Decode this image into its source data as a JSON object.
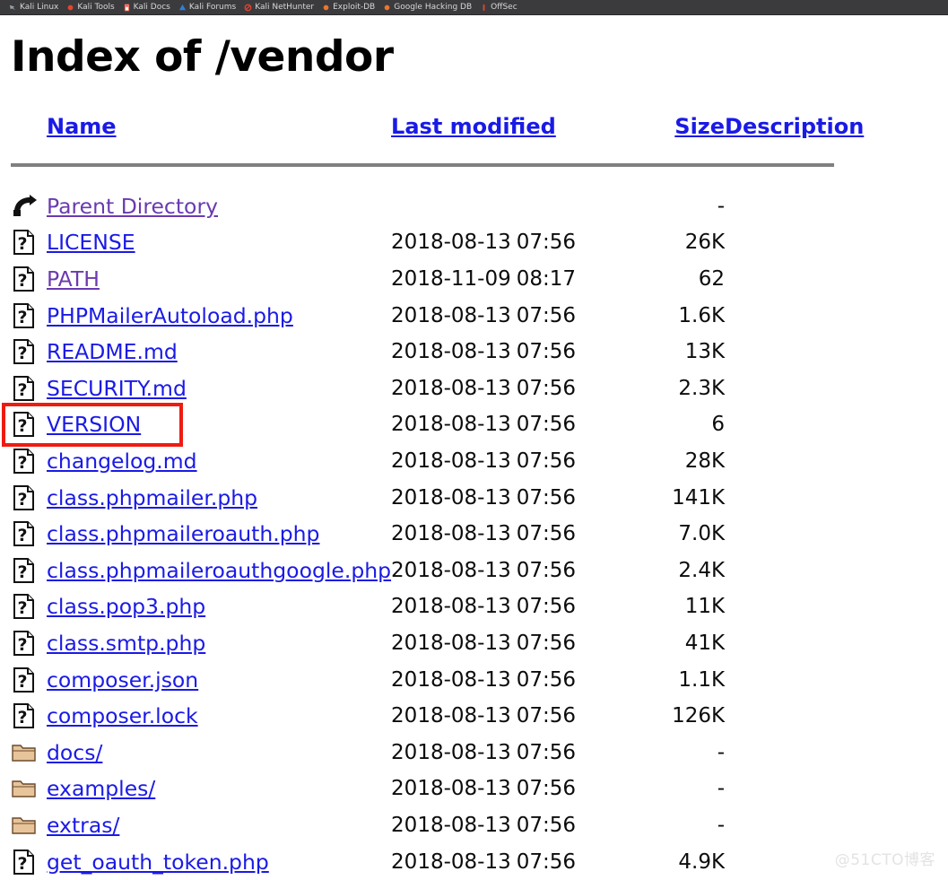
{
  "browser": {
    "bookmarks": [
      {
        "label": "Kali Linux",
        "icon": "kali-dragon-icon",
        "color": "#9aa0a6"
      },
      {
        "label": "Kali Tools",
        "icon": "kali-tools-icon",
        "color": "#e8442e"
      },
      {
        "label": "Kali Docs",
        "icon": "kali-docs-icon",
        "color": "#e8442e"
      },
      {
        "label": "Kali Forums",
        "icon": "kali-forums-icon",
        "color": "#2f7fd4"
      },
      {
        "label": "Kali NetHunter",
        "icon": "kali-nethunter-icon",
        "color": "#e8442e"
      },
      {
        "label": "Exploit-DB",
        "icon": "exploit-db-icon",
        "color": "#e8762e"
      },
      {
        "label": "Google Hacking DB",
        "icon": "google-hacking-db-icon",
        "color": "#e8762e"
      },
      {
        "label": "OffSec",
        "icon": "offsec-icon",
        "color": "#e8442e"
      }
    ]
  },
  "page": {
    "title": "Index of /vendor",
    "watermark": "@51CTO博客",
    "colors": {
      "link": "#1a1ae6",
      "link_visited": "#6a3ab0",
      "highlight": "#ee1b11",
      "rule": "#808080"
    },
    "columns": [
      {
        "key": "name",
        "label": "Name"
      },
      {
        "key": "lastmodified",
        "label": "Last modified"
      },
      {
        "key": "size",
        "label": "Size"
      },
      {
        "key": "description",
        "label": "Description"
      }
    ],
    "rows": [
      {
        "icon": "parent-directory-icon",
        "name": "Parent Directory",
        "visited": true,
        "date": "",
        "time": "",
        "size": "-",
        "description": ""
      },
      {
        "icon": "unknown-file-icon",
        "name": "LICENSE",
        "visited": false,
        "date": "2018-08-13",
        "time": "07:56",
        "size": "26K",
        "description": ""
      },
      {
        "icon": "unknown-file-icon",
        "name": "PATH",
        "visited": true,
        "date": "2018-11-09",
        "time": "08:17",
        "size": "62",
        "description": ""
      },
      {
        "icon": "unknown-file-icon",
        "name": "PHPMailerAutoload.php",
        "visited": false,
        "date": "2018-08-13",
        "time": "07:56",
        "size": "1.6K",
        "description": ""
      },
      {
        "icon": "unknown-file-icon",
        "name": "README.md",
        "visited": false,
        "date": "2018-08-13",
        "time": "07:56",
        "size": "13K",
        "description": ""
      },
      {
        "icon": "unknown-file-icon",
        "name": "SECURITY.md",
        "visited": false,
        "date": "2018-08-13",
        "time": "07:56",
        "size": "2.3K",
        "description": ""
      },
      {
        "icon": "unknown-file-icon",
        "name": "VERSION",
        "visited": false,
        "date": "2018-08-13",
        "time": "07:56",
        "size": "6",
        "description": "",
        "highlighted": true
      },
      {
        "icon": "unknown-file-icon",
        "name": "changelog.md",
        "visited": false,
        "date": "2018-08-13",
        "time": "07:56",
        "size": "28K",
        "description": ""
      },
      {
        "icon": "unknown-file-icon",
        "name": "class.phpmailer.php",
        "visited": false,
        "date": "2018-08-13",
        "time": "07:56",
        "size": "141K",
        "description": ""
      },
      {
        "icon": "unknown-file-icon",
        "name": "class.phpmaileroauth.php",
        "visited": false,
        "date": "2018-08-13",
        "time": "07:56",
        "size": "7.0K",
        "description": ""
      },
      {
        "icon": "unknown-file-icon",
        "name": "class.phpmaileroauthgoogle.php",
        "visited": false,
        "date": "2018-08-13",
        "time": "07:56",
        "size": "2.4K",
        "description": ""
      },
      {
        "icon": "unknown-file-icon",
        "name": "class.pop3.php",
        "visited": false,
        "date": "2018-08-13",
        "time": "07:56",
        "size": "11K",
        "description": ""
      },
      {
        "icon": "unknown-file-icon",
        "name": "class.smtp.php",
        "visited": false,
        "date": "2018-08-13",
        "time": "07:56",
        "size": "41K",
        "description": ""
      },
      {
        "icon": "unknown-file-icon",
        "name": "composer.json",
        "visited": false,
        "date": "2018-08-13",
        "time": "07:56",
        "size": "1.1K",
        "description": ""
      },
      {
        "icon": "unknown-file-icon",
        "name": "composer.lock",
        "visited": false,
        "date": "2018-08-13",
        "time": "07:56",
        "size": "126K",
        "description": ""
      },
      {
        "icon": "folder-icon",
        "name": "docs/",
        "visited": false,
        "date": "2018-08-13",
        "time": "07:56",
        "size": "-",
        "description": ""
      },
      {
        "icon": "folder-icon",
        "name": "examples/",
        "visited": false,
        "date": "2018-08-13",
        "time": "07:56",
        "size": "-",
        "description": ""
      },
      {
        "icon": "folder-icon",
        "name": "extras/",
        "visited": false,
        "date": "2018-08-13",
        "time": "07:56",
        "size": "-",
        "description": ""
      },
      {
        "icon": "unknown-file-icon",
        "name": "get_oauth_token.php",
        "visited": false,
        "date": "2018-08-13",
        "time": "07:56",
        "size": "4.9K",
        "description": ""
      }
    ]
  }
}
